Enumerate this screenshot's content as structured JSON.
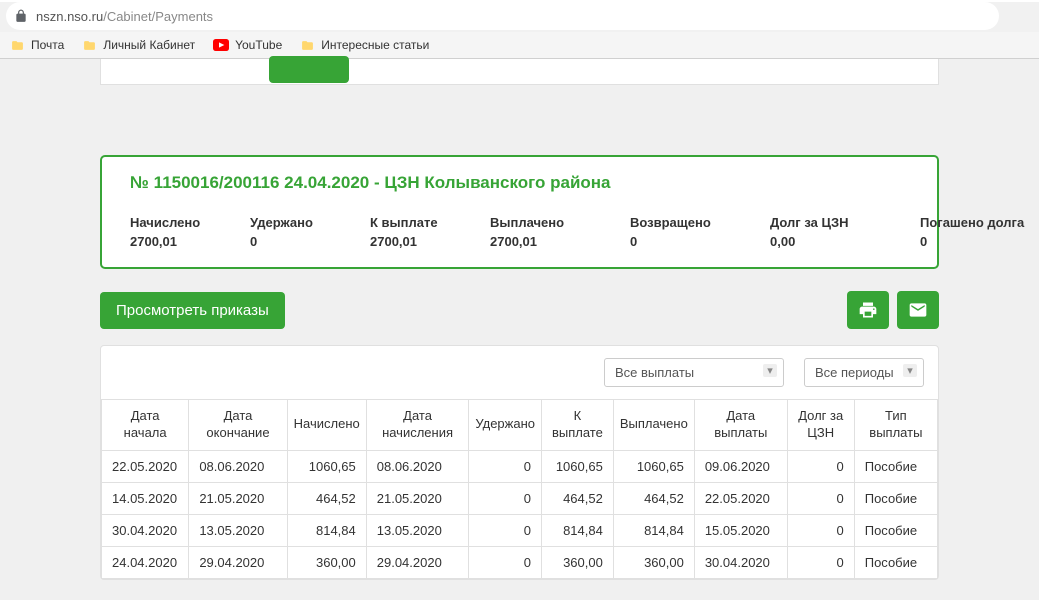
{
  "browser": {
    "url_host": "nszn.nso.ru",
    "url_path": "/Cabinet/Payments",
    "bookmarks": [
      "Почта",
      "Личный Кабинет",
      "YouTube",
      "Интересные статьи"
    ]
  },
  "summary": {
    "title": "№ 1150016/200116 24.04.2020 - ЦЗН Колыванского района",
    "cols": [
      {
        "label": "Начислено",
        "value": "2700,01"
      },
      {
        "label": "Удержано",
        "value": "0"
      },
      {
        "label": "К выплате",
        "value": "2700,01"
      },
      {
        "label": "Выплачено",
        "value": "2700,01"
      },
      {
        "label": "Возвращено",
        "value": "0"
      },
      {
        "label": "Долг за ЦЗН",
        "value": "0,00"
      },
      {
        "label": "Погашено долга",
        "value": "0"
      }
    ]
  },
  "actions": {
    "view_orders": "Просмотреть приказы"
  },
  "filters": {
    "payments": "Все выплаты",
    "periods": "Все периоды"
  },
  "table": {
    "headers": [
      "Дата начала",
      "Дата окончание",
      "Начислено",
      "Дата начисления",
      "Удержано",
      "К выплате",
      "Выплачено",
      "Дата выплаты",
      "Долг за ЦЗН",
      "Тип выплаты"
    ],
    "rows": [
      [
        "22.05.2020",
        "08.06.2020",
        "1060,65",
        "08.06.2020",
        "0",
        "1060,65",
        "1060,65",
        "09.06.2020",
        "0",
        "Пособие"
      ],
      [
        "14.05.2020",
        "21.05.2020",
        "464,52",
        "21.05.2020",
        "0",
        "464,52",
        "464,52",
        "22.05.2020",
        "0",
        "Пособие"
      ],
      [
        "30.04.2020",
        "13.05.2020",
        "814,84",
        "13.05.2020",
        "0",
        "814,84",
        "814,84",
        "15.05.2020",
        "0",
        "Пособие"
      ],
      [
        "24.04.2020",
        "29.04.2020",
        "360,00",
        "29.04.2020",
        "0",
        "360,00",
        "360,00",
        "30.04.2020",
        "0",
        "Пособие"
      ]
    ]
  }
}
